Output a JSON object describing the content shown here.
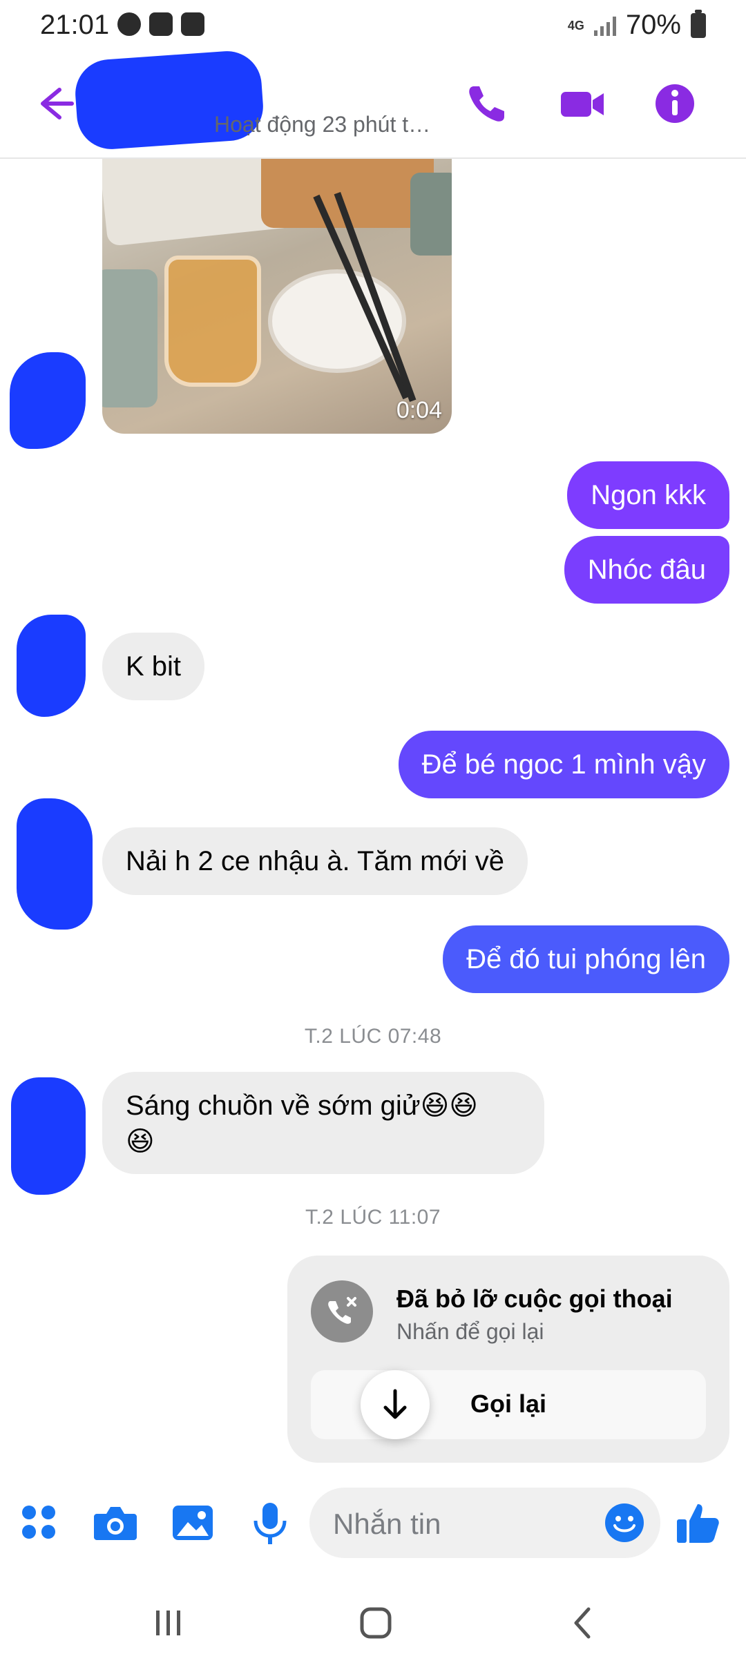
{
  "status_bar": {
    "time": "21:01",
    "network": "4G",
    "battery": "70%"
  },
  "header": {
    "subtitle": "Hoạt động 23 phút trước"
  },
  "colors": {
    "accent": "#8a2be2",
    "outgoing_top": "#7e3cff",
    "outgoing_bottom": "#4b5bfc",
    "scribble": "#1a3cff"
  },
  "video": {
    "duration": "0:04"
  },
  "messages": [
    {
      "direction": "out",
      "text": "Ngon kkk"
    },
    {
      "direction": "out",
      "text": "Nhóc đâu"
    },
    {
      "direction": "in",
      "text": "K bit"
    },
    {
      "direction": "out",
      "text": "Để bé ngoc 1 mình vậy"
    },
    {
      "direction": "in",
      "text": "Nải h 2 ce nhậu à. Tăm mới về"
    },
    {
      "direction": "out",
      "text": "Để đó tui phóng lên"
    },
    {
      "direction": "in",
      "text": "Sáng chuồn về sớm giử😆😆",
      "text_line2": "😆"
    }
  ],
  "timestamps": [
    "T.2 LÚC 07:48",
    "T.2 LÚC 11:07"
  ],
  "missed_call": {
    "title": "Đã bỏ lỡ cuộc gọi thoại",
    "subtitle": "Nhấn để gọi lại",
    "callback_label": "Gọi lại"
  },
  "composer": {
    "placeholder": "Nhắn tin"
  },
  "icons": [
    "back-arrow-icon",
    "phone-icon",
    "video-call-icon",
    "info-icon",
    "apps-grid-icon",
    "camera-icon",
    "gallery-icon",
    "microphone-icon",
    "emoji-icon",
    "like-icon"
  ]
}
